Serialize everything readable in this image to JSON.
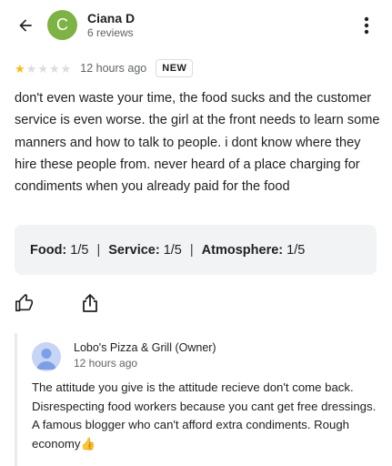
{
  "header": {
    "back_icon": "arrow-left-icon",
    "avatar_initial": "C",
    "avatar_color": "#7cb342",
    "reviewer_name": "Ciana D",
    "reviewer_subtitle": "6 reviews",
    "more_icon": "more-vertical-icon"
  },
  "review": {
    "rating": 1,
    "max_rating": 5,
    "time": "12 hours ago",
    "badge": "NEW",
    "text": "don't even waste your time, the food sucks and the customer service is even worse. the girl at the front needs to learn some manners and how to talk to people. i dont know where they hire these people from. never heard of a place charging for condiments when you already paid for the food",
    "star_color": "#fbbc04"
  },
  "ratings": {
    "food_label": "Food:",
    "food_value": "1/5",
    "service_label": "Service:",
    "service_value": "1/5",
    "atmosphere_label": "Atmosphere:",
    "atmosphere_value": "1/5",
    "separator": "|"
  },
  "actions": {
    "like_icon": "thumb-up-icon",
    "share_icon": "share-icon"
  },
  "owner_reply": {
    "name": "Lobo's Pizza & Grill (Owner)",
    "time": "12 hours ago",
    "text": "The attitude you give is the attitude recieve don't come back. Disrespecting food workers because you cant get free dressings. A famous blogger who can't afford extra condiments. Rough economy👍"
  }
}
